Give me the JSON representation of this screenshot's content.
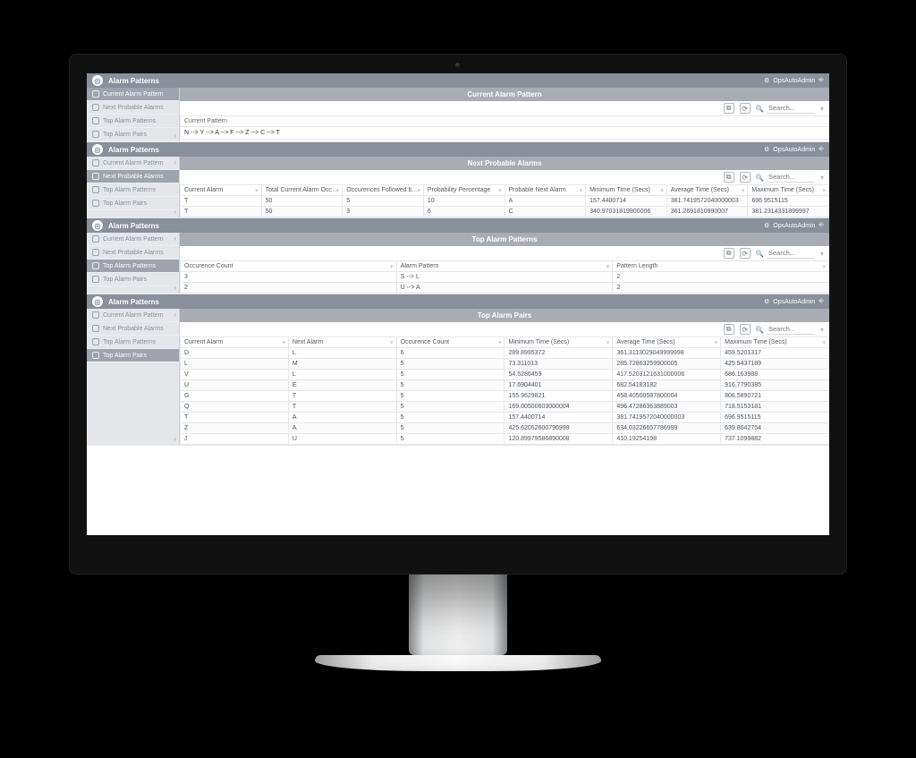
{
  "app_title": "Alarm Patterns",
  "user_label": "OpsAutoAdmin",
  "search_placeholder": "Search...",
  "sidebar": {
    "items": [
      {
        "label": "Current Alarm Pattern"
      },
      {
        "label": "Next Probable Alarms"
      },
      {
        "label": "Top Alarm Patterns"
      },
      {
        "label": "Top Alarm Pairs"
      }
    ]
  },
  "panels": [
    {
      "title": "Current Alarm Pattern",
      "active_index": 0,
      "current_pattern_label": "Current Pattern",
      "current_pattern_value": "N --> Y --> A --> F --> Z --> C --> T"
    },
    {
      "title": "Next Probable Alarms",
      "active_index": 1,
      "columns": [
        "Current Alarm",
        "Total Current Alarm Occurences",
        "Occurences Followed by Next Alarm",
        "Probability Percentage",
        "Probable Next Alarm",
        "Minimum Time (Secs)",
        "Average Time (Secs)",
        "Maximum Time (Secs)"
      ],
      "rows": [
        [
          "T",
          "50",
          "5",
          "10",
          "A",
          "157.4400714",
          "381.7419572040000003",
          "696.9515115"
        ],
        [
          "T",
          "50",
          "3",
          "6",
          "C",
          "340.97031819900006",
          "361.2691810990007",
          "381.2314331899997"
        ]
      ]
    },
    {
      "title": "Top Alarm Patterns",
      "active_index": 2,
      "columns": [
        "Occurence Count",
        "Alarm Pattern",
        "Pattern Length"
      ],
      "rows": [
        [
          "3",
          "S --> L",
          "2"
        ],
        [
          "2",
          "U --> A",
          "2"
        ]
      ]
    },
    {
      "title": "Top Alarm Pairs",
      "active_index": 3,
      "columns": [
        "Current Alarm",
        "Next Alarm",
        "Occurence Count",
        "Minimum Time (Secs)",
        "Average Time (Secs)",
        "Maximum Time (Secs)"
      ],
      "rows": [
        [
          "D",
          "L",
          "6",
          "289.8995372",
          "361.3113029049999998",
          "459.5201317"
        ],
        [
          "L",
          "M",
          "5",
          "73.311013",
          "285.72863259900005",
          "425.5437189"
        ],
        [
          "V",
          "L",
          "5",
          "54.5286459",
          "417.5203121631000006",
          "686.163988"
        ],
        [
          "U",
          "E",
          "5",
          "17.6904401",
          "682.54183182",
          "916.7790385"
        ],
        [
          "G",
          "T",
          "5",
          "155.9629821",
          "458.40500587800004",
          "806.5890721"
        ],
        [
          "Q",
          "T",
          "5",
          "169.00500603000004",
          "496.47286363889003",
          "718.5153181"
        ],
        [
          "T",
          "A",
          "5",
          "157.4400714",
          "381.7419572040000003",
          "696.9515115"
        ],
        [
          "Z",
          "A",
          "5",
          "425.62052600796999",
          "634.03226657786999",
          "639.8642754"
        ],
        [
          "J",
          "U",
          "5",
          "120.89979586890008",
          "410.19254198",
          "737.1099882"
        ]
      ]
    }
  ]
}
